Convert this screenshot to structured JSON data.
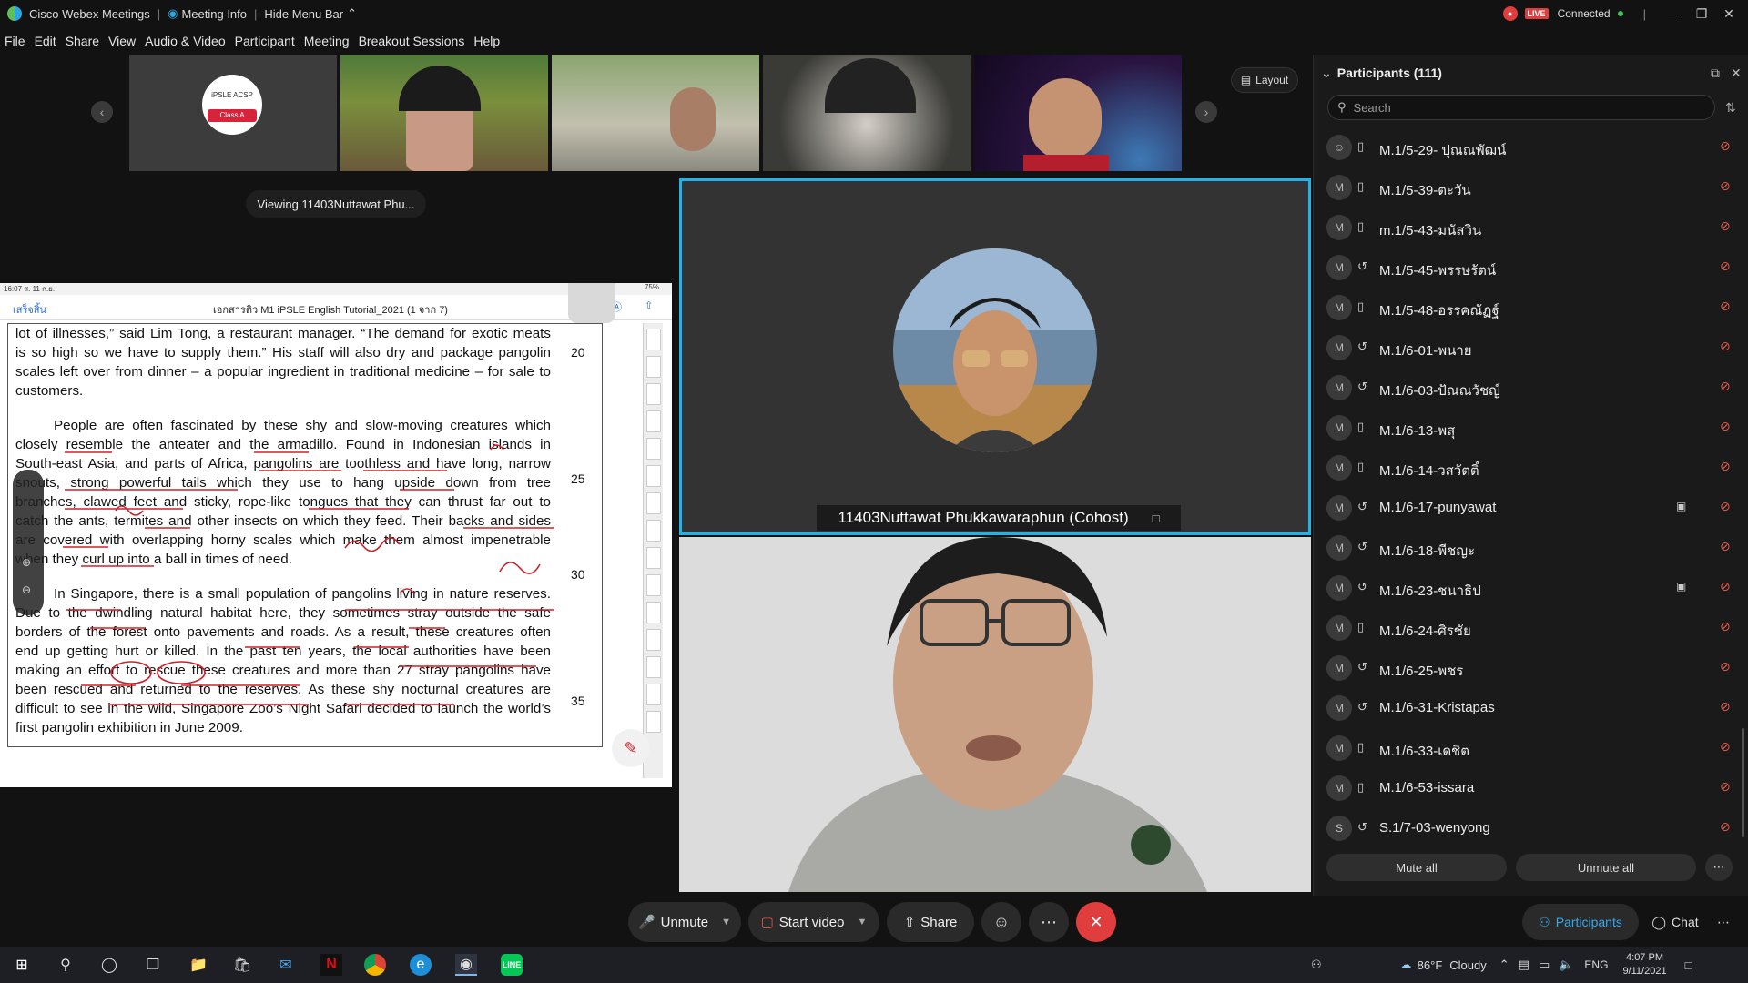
{
  "titlebar": {
    "app": "Cisco Webex Meetings",
    "meeting_info": "Meeting Info",
    "hide_menu": "Hide Menu Bar",
    "live": "LIVE",
    "connection": "Connected"
  },
  "menu": [
    "File",
    "Edit",
    "Share",
    "View",
    "Audio & Video",
    "Participant",
    "Meeting",
    "Breakout Sessions",
    "Help"
  ],
  "layout_label": "Layout",
  "viewing_label": "Viewing 11403Nuttawat Phu...",
  "document": {
    "status_time": "16:07  ส. 11 ก.ย.",
    "status_right": "75%",
    "done_label": "เสร็จสิ้น",
    "title": "เอกสารติว M1 iPSLE English Tutorial_2021 (1 จาก 7)",
    "para1": [
      {
        "text": "lot of illnesses,” said Lim Tong, a restaurant manager. “The demand for exotic meats",
        "num": ""
      },
      {
        "text": "is so high so we have to supply them.” His staff will also dry and package pangolin",
        "num": "20"
      },
      {
        "text": "scales left over from dinner – a popular ingredient in traditional medicine – for sale to",
        "num": ""
      },
      {
        "text": "customers.",
        "num": ""
      }
    ],
    "para2": [
      {
        "text": "People are often fascinated by these shy and slow-moving creatures which",
        "num": ""
      },
      {
        "text": "closely resemble the anteater and the armadillo. Found in Indonesian islands in",
        "num": ""
      },
      {
        "text": "South-east Asia, and parts of Africa, pangolins are toothless and have long, narrow",
        "num": "25"
      },
      {
        "text": "snouts, strong powerful tails which they use to hang upside down from tree",
        "num": ""
      },
      {
        "text": "branches, clawed feet and sticky, rope-like tongues that they can thrust far out to",
        "num": ""
      },
      {
        "text": "catch the ants, termites and other insects on which they feed. Their backs and sides",
        "num": ""
      },
      {
        "text": "are covered with overlapping horny scales which make them almost impenetrable",
        "num": ""
      },
      {
        "text": "when they curl up into a ball in times of need.",
        "num": "30"
      }
    ],
    "para3": [
      {
        "text": "In Singapore, there is a small population of pangolins living in nature reserves.",
        "num": ""
      },
      {
        "text": "Due to the dwindling natural habitat here, they sometimes stray outside the safe",
        "num": ""
      },
      {
        "text": "borders of the forest onto pavements and roads. As a result, these creatures often",
        "num": ""
      },
      {
        "text": "end up getting hurt or killed. In the past ten years, the local authorities have been",
        "num": ""
      },
      {
        "text": "making an effort to rescue these creatures and more than 27 stray pangolins have",
        "num": "35"
      },
      {
        "text": "been rescued and returned to the reserves. As these shy nocturnal creatures are",
        "num": ""
      },
      {
        "text": "difficult to see in the wild, Singapore Zoo’s Night Safari decided to launch the world’s",
        "num": ""
      },
      {
        "text": "first pangolin exhibition in June 2009.",
        "num": ""
      }
    ]
  },
  "thumb_badge": {
    "line1": "iPSLE  ACSP",
    "line2": "Class A"
  },
  "active_speaker_name": "11403Nuttawat Phukkawaraphun  (Cohost)",
  "participants": {
    "title": "Participants (111)",
    "search_placeholder": "Search",
    "list": [
      {
        "initial": "",
        "name": "M.1/5-29- ปุณณพัฒน์",
        "device": "mobile",
        "video": false
      },
      {
        "initial": "M",
        "name": "M.1/5-39-ตะวัน",
        "device": "mobile",
        "video": false
      },
      {
        "initial": "M",
        "name": "m.1/5-43-มนัสวิน",
        "device": "mobile",
        "video": false
      },
      {
        "initial": "M",
        "name": "M.1/5-45-พรรษรัตน์",
        "device": "web",
        "video": false
      },
      {
        "initial": "M",
        "name": "M.1/5-48-อรรคณัฏฐ์",
        "device": "mobile",
        "video": false
      },
      {
        "initial": "M",
        "name": "M.1/6-01-พนาย",
        "device": "web",
        "video": false
      },
      {
        "initial": "M",
        "name": "M.1/6-03-ปัณณวัชญ์",
        "device": "web",
        "video": false
      },
      {
        "initial": "M",
        "name": "M.1/6-13-พสุ",
        "device": "mobile",
        "video": false
      },
      {
        "initial": "M",
        "name": "M.1/6-14-วสวัตติ์",
        "device": "mobile",
        "video": false
      },
      {
        "initial": "M",
        "name": "M.1/6-17-punyawat",
        "device": "web",
        "video": true
      },
      {
        "initial": "M",
        "name": "M.1/6-18-พีชญะ",
        "device": "web",
        "video": false
      },
      {
        "initial": "M",
        "name": "M.1/6-23-ชนาธิป",
        "device": "web",
        "video": true
      },
      {
        "initial": "M",
        "name": "M.1/6-24-ศิรชัย",
        "device": "mobile",
        "video": false
      },
      {
        "initial": "M",
        "name": "M.1/6-25-พชร",
        "device": "web",
        "video": false
      },
      {
        "initial": "M",
        "name": "M.1/6-31-Kristapas",
        "device": "web",
        "video": false
      },
      {
        "initial": "M",
        "name": "M.1/6-33-เดชิต",
        "device": "mobile",
        "video": false
      },
      {
        "initial": "M",
        "name": "M.1/6-53-issara",
        "device": "mobile",
        "video": false
      },
      {
        "initial": "S",
        "name": "S.1/7-03-wenyong",
        "device": "web",
        "video": false
      }
    ],
    "mute_all": "Mute all",
    "unmute_all": "Unmute all"
  },
  "controls": {
    "unmute": "Unmute",
    "start_video": "Start video",
    "share": "Share",
    "participants_tab": "Participants",
    "chat_tab": "Chat"
  },
  "taskbar": {
    "temp": "86°F",
    "weather": "Cloudy",
    "lang": "ENG",
    "time": "4:07 PM",
    "date": "9/11/2021"
  },
  "colors": {
    "accent": "#1fb3e8",
    "danger": "#e03e3e",
    "ink": "#d0202a"
  }
}
